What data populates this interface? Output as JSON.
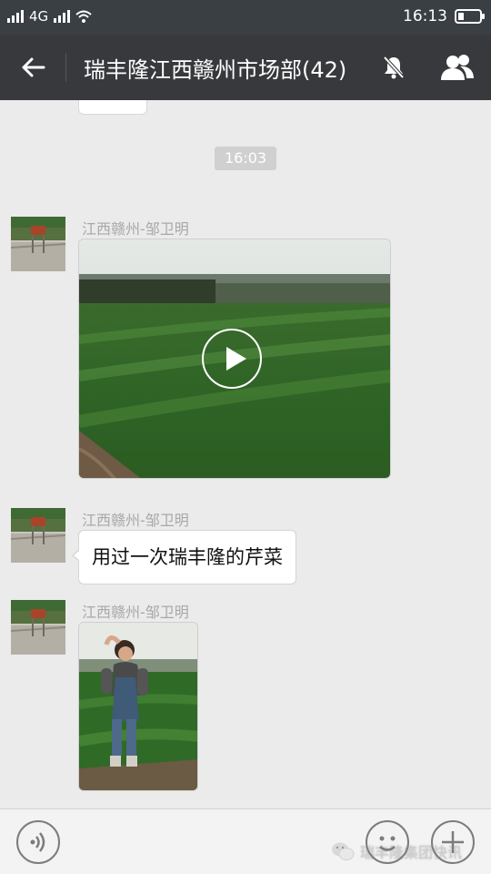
{
  "status_bar": {
    "network": "4G",
    "time": "16:13"
  },
  "header": {
    "title": "瑞丰隆江西赣州市场部(42)",
    "back_icon": "arrow-left-icon",
    "mute_icon": "bell-off-icon",
    "members_icon": "group-icon"
  },
  "chat": {
    "timestamp": "16:03",
    "messages": [
      {
        "sender": "江西赣州-邹卫明",
        "type": "video"
      },
      {
        "sender": "江西赣州-邹卫明",
        "type": "text",
        "text": "用过一次瑞丰隆的芹菜"
      },
      {
        "sender": "江西赣州-邹卫明",
        "type": "image"
      }
    ]
  },
  "input_bar": {
    "voice_icon": "voice-icon",
    "emoji_icon": "emoji-icon",
    "plus_icon": "plus-icon"
  },
  "watermarks": {
    "left": "",
    "right": "瑞丰隆集团快讯"
  },
  "colors": {
    "header_bg": "#38393d",
    "status_bg": "#3a3f44",
    "chat_bg": "#ebebeb"
  }
}
